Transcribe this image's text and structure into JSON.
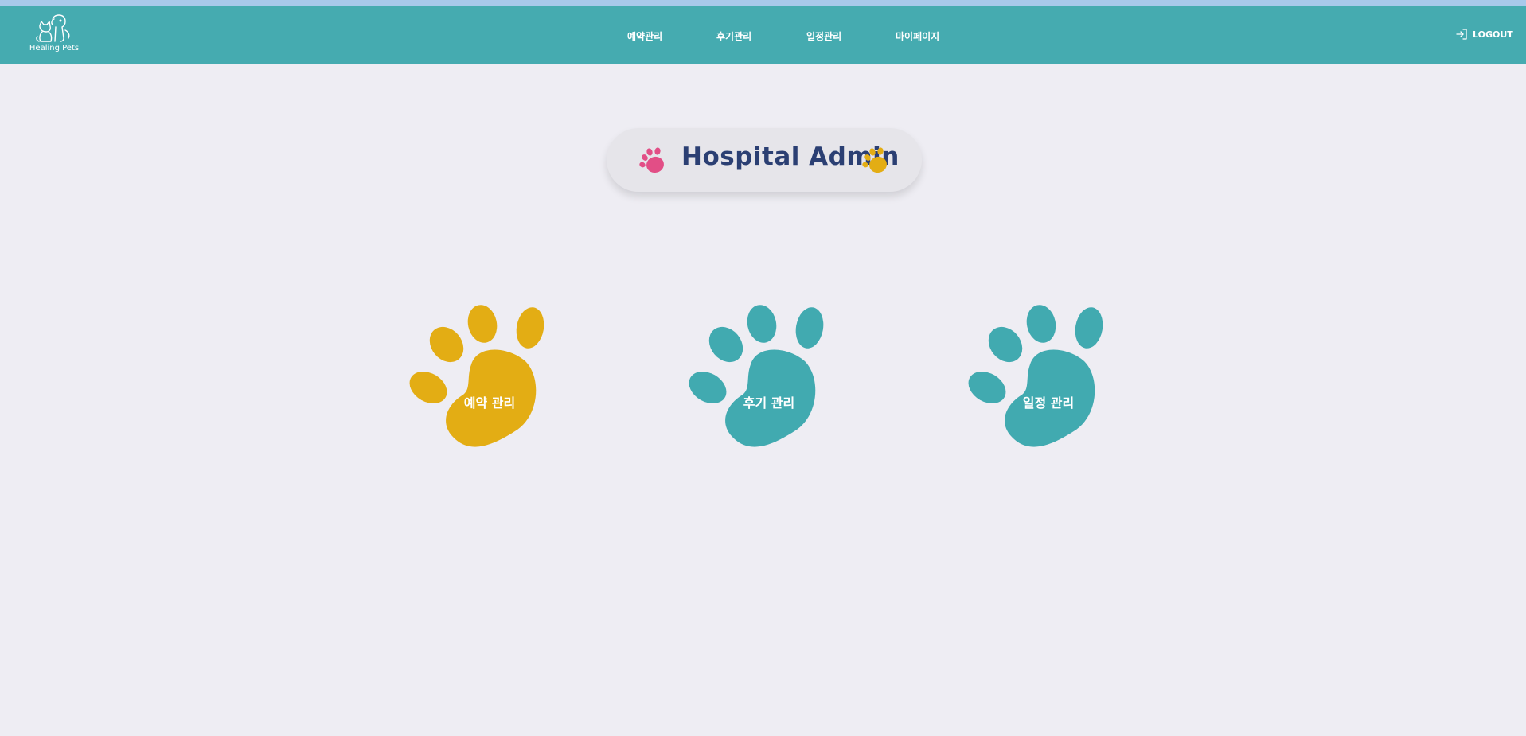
{
  "header": {
    "logo_text": "Healing Pets",
    "nav_items": [
      {
        "label": "예약관리"
      },
      {
        "label": "후기관리"
      },
      {
        "label": "일정관리"
      },
      {
        "label": "마이페이지"
      }
    ],
    "logout_label": "LOGOUT"
  },
  "main": {
    "title": "Hospital Admin",
    "cards": [
      {
        "label": "예약 관리",
        "color": "#e3ad14"
      },
      {
        "label": "후기 관리",
        "color": "#41aab0"
      },
      {
        "label": "일정 관리",
        "color": "#41aab0"
      }
    ]
  },
  "colors": {
    "navbar": "#45abb0",
    "top_strip": "#a7c9ea",
    "background": "#eeedf3",
    "title_text": "#2b3f73",
    "paw_pink": "#e24e86",
    "paw_yellow": "#e3ad14"
  },
  "icons": {
    "logo": "dog-and-cat-icon",
    "logout": "sign-in-arrow-icon",
    "title_left": "paw-icon",
    "title_right": "paw-icon"
  }
}
